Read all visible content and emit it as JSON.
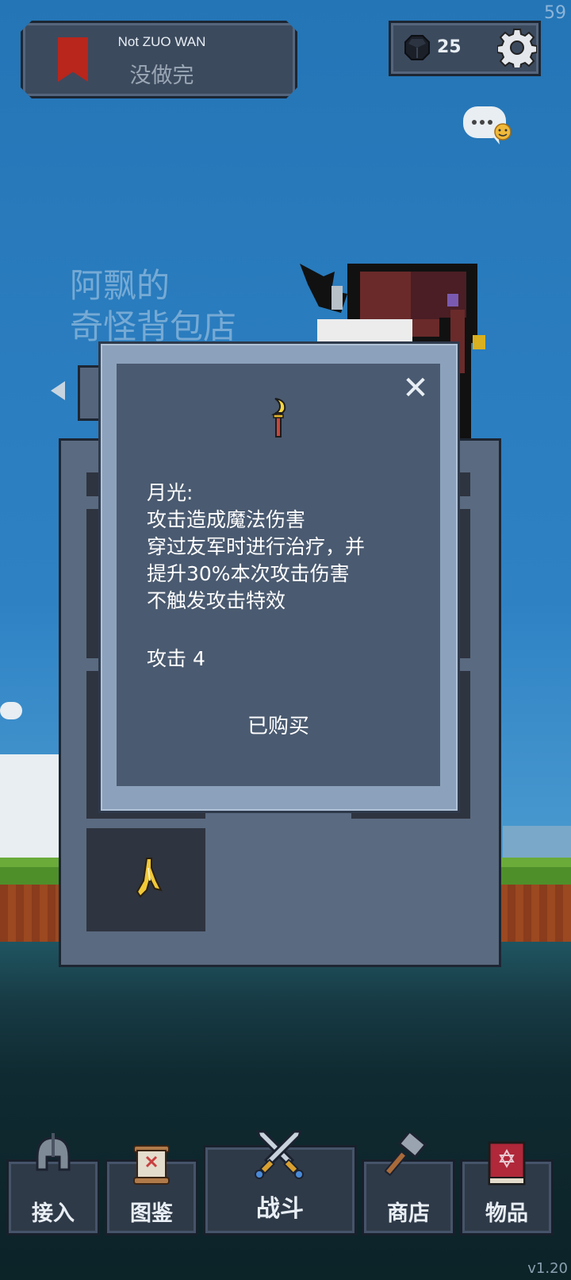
{
  "hud": {
    "fps": "59",
    "version": "v1.20",
    "title_en": "Not ZUO WAN",
    "title_cn": "没做完",
    "gems": "25"
  },
  "shop": {
    "name_line1": "阿飘的",
    "name_line2": "奇怪背包店"
  },
  "popup": {
    "description": "月光:\n攻击造成魔法伤害\n穿过友军时进行治疗，并\n提升30%本次攻击伤害\n不触发攻击特效",
    "attack": "攻击  4",
    "status": "已购买",
    "close": "✕"
  },
  "nav": {
    "items": [
      {
        "label": "接入",
        "icon": "helmet-icon"
      },
      {
        "label": "图鉴",
        "icon": "scroll-icon"
      },
      {
        "label": "战斗",
        "icon": "crossed-swords-icon"
      },
      {
        "label": "商店",
        "icon": "hammer-icon"
      },
      {
        "label": "物品",
        "icon": "spellbook-icon"
      }
    ]
  },
  "colors": {
    "sky": "#2e82c4",
    "panel": "#3c4a5e",
    "popup_bg": "#4a5a70",
    "bookmark": "#b8261c"
  }
}
